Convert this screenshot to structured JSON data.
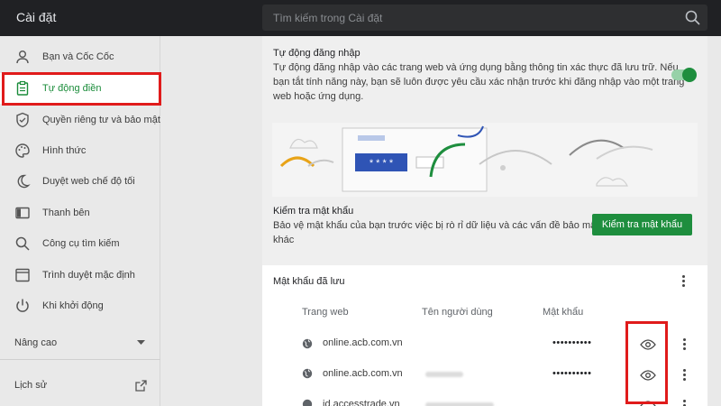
{
  "window": {
    "title": "Cài đặt"
  },
  "search": {
    "placeholder": "Tìm kiếm trong Cài đặt"
  },
  "sidebar": {
    "items": [
      {
        "label": "Bạn và Cốc Cốc",
        "icon": "person-icon"
      },
      {
        "label": "Tự động điền",
        "icon": "clipboard-icon",
        "active": true
      },
      {
        "label": "Quyền riêng tư và bảo mật",
        "icon": "shield-icon"
      },
      {
        "label": "Hình thức",
        "icon": "palette-icon"
      },
      {
        "label": "Duyệt web chế độ tối",
        "icon": "moon-icon"
      },
      {
        "label": "Thanh bên",
        "icon": "sidebar-icon"
      },
      {
        "label": "Công cụ tìm kiếm",
        "icon": "search-icon"
      },
      {
        "label": "Trình duyệt mặc định",
        "icon": "browser-icon"
      },
      {
        "label": "Khi khởi động",
        "icon": "power-icon"
      }
    ],
    "advanced_label": "Nâng cao",
    "history_label": "Lịch sử"
  },
  "autologin": {
    "title": "Tự động đăng nhập",
    "line1": "Tự động đăng nhập vào các trang web và ứng dụng bằng thông tin xác thực đã lưu trữ. Nếu",
    "line2": "bạn tắt tính năng này, bạn sẽ luôn được yêu cầu xác nhận trước khi đăng nhập vào một trang",
    "line3": "web hoặc ứng dụng.",
    "enabled": true
  },
  "illustration": {
    "password_mask": "* * * *"
  },
  "password_check": {
    "title": "Kiểm tra mật khẩu",
    "line1": "Bảo vệ mật khẩu của bạn trước việc bị rò rỉ dữ liệu và các vấn đề bảo mật",
    "line2": "khác",
    "button": "Kiểm tra mật khẩu"
  },
  "saved_passwords": {
    "title": "Mật khẩu đã lưu",
    "columns": [
      "Trang web",
      "Tên người dùng",
      "Mật khẩu"
    ],
    "rows": [
      {
        "site": "online.acb.com.vn",
        "password": "••••••••••"
      },
      {
        "site": "online.acb.com.vn",
        "password": "••••••••••"
      },
      {
        "site": "id.accesstrade.vn",
        "password": ""
      }
    ]
  },
  "colors": {
    "accent": "#1e8e3e",
    "highlight": "#e01b1b",
    "topbar": "#202124"
  }
}
